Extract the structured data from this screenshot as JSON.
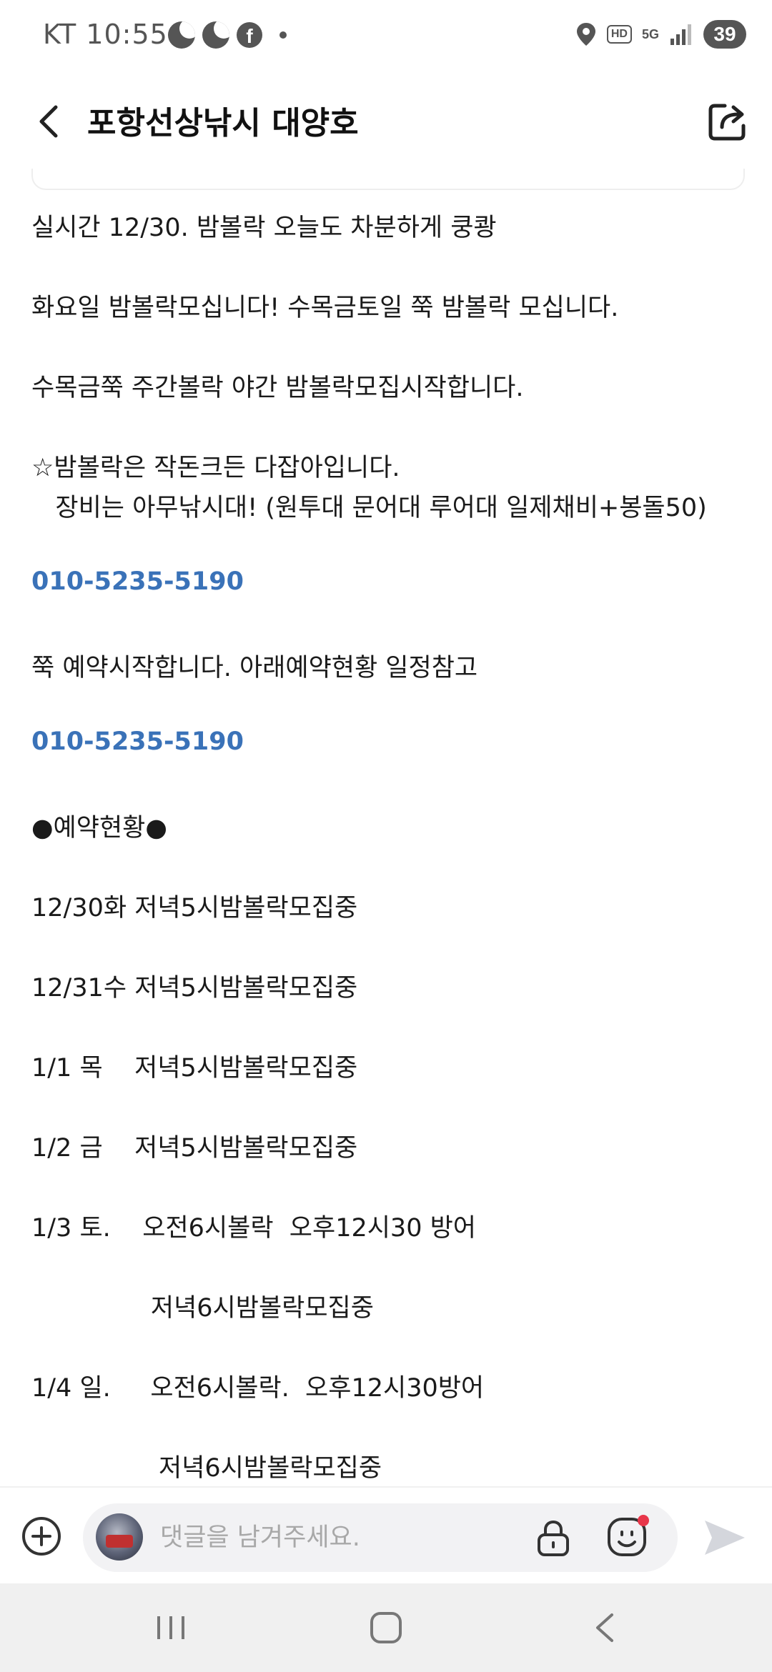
{
  "status_bar": {
    "carrier": "KT",
    "time": "10:55",
    "left_icons": [
      "moon-icon",
      "moon-icon",
      "facebook-icon",
      "notification-dot"
    ],
    "right_icons": [
      "location-icon",
      "hd-icon",
      "5g-icon",
      "signal-icon"
    ],
    "hd_label": "HD",
    "network_label": "5G",
    "battery": "39"
  },
  "header": {
    "title": "포항선상낚시 대양호",
    "back_icon": "chevron-left-icon",
    "share_icon": "share-icon"
  },
  "post": {
    "lines": [
      "실시간 12/30. 밤볼락 오늘도 차분하게 쿵쾅",
      "화요일 밤볼락모십니다! 수목금토일 쭉 밤볼락 모십니다.",
      "수목금쭉 주간볼락 야간 밤볼락모집시작합니다.",
      "☆밤볼락은 작돈크든 다잡아입니다.",
      "   장비는 아무낚시대! (원투대 문어대 루어대 일제채비+봉돌50)",
      "010-5235-5190",
      "쭉 예약시작합니다. 아래예약현황 일정참고",
      "010-5235-5190",
      "●예약현황●",
      "12/30화 저녁5시밤볼락모집중",
      "12/31수 저녁5시밤볼락모집중",
      "1/1 목    저녁5시밤볼락모집중",
      "1/2 금    저녁5시밤볼락모집중",
      "1/3 토.    오전6시볼락  오후12시30 방어",
      "               저녁6시밤볼락모집중",
      "1/4 일.     오전6시볼락.  오후12시30방어",
      "                저녁6시밤볼락모집중"
    ]
  },
  "comment_bar": {
    "placeholder": "댓글을 남겨주세요.",
    "add_icon": "plus-circle-icon",
    "lock_icon": "lock-icon",
    "emoji_icon": "emoji-icon",
    "send_icon": "send-icon"
  },
  "nav_bar": {
    "recent_icon": "recent-apps-icon",
    "home_icon": "home-icon",
    "back_icon": "back-icon"
  },
  "colors": {
    "link": "#3a72b8",
    "text": "#1a1a1a",
    "icon": "#333333",
    "notification": "#e8364a"
  }
}
